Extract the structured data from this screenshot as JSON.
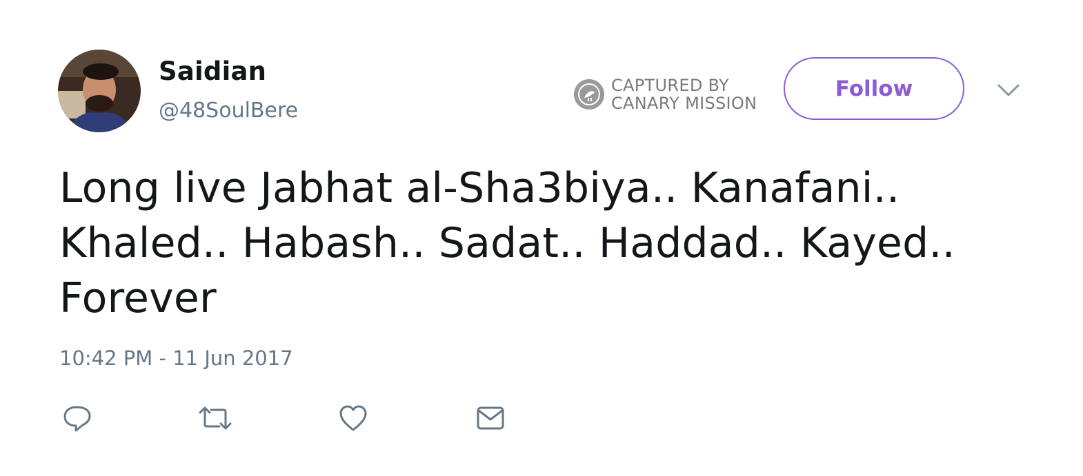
{
  "user": {
    "display_name": "Saidian",
    "handle": "@48SoulBere"
  },
  "watermark": {
    "line1": "CAPTURED BY",
    "line2": "CANARY MISSION"
  },
  "follow_button": {
    "label": "Follow"
  },
  "tweet": {
    "text": "Long live Jabhat al-Sha3biya.. Kanafani.. Khaled.. Habash.. Sadat.. Haddad.. Kayed.. Forever",
    "timestamp": "10:42 PM - 11 Jun 2017"
  },
  "actions": {
    "reply_icon": "speech-bubble",
    "retweet_icon": "retweet-arrows",
    "like_icon": "heart",
    "dm_icon": "envelope"
  },
  "colors": {
    "accent": "#8c5cd6",
    "text": "#14171a",
    "secondary": "#657786"
  }
}
